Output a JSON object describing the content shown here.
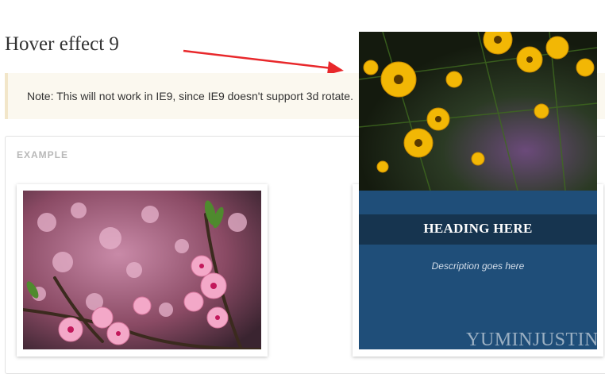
{
  "page": {
    "title": "Hover effect 9"
  },
  "note": {
    "text": "Note: This will not work in IE9, since IE9 doesn't support 3d rotate."
  },
  "example": {
    "label": "EXAMPLE"
  },
  "flip_card": {
    "heading": "HEADING HERE",
    "description": "Description goes here",
    "panel_color": "#1f4e79",
    "band_color": "#16344f"
  },
  "watermark": "YUMINJUSTIN",
  "colors": {
    "arrow": "#e8282b",
    "note_bg": "#fbf8ef"
  }
}
